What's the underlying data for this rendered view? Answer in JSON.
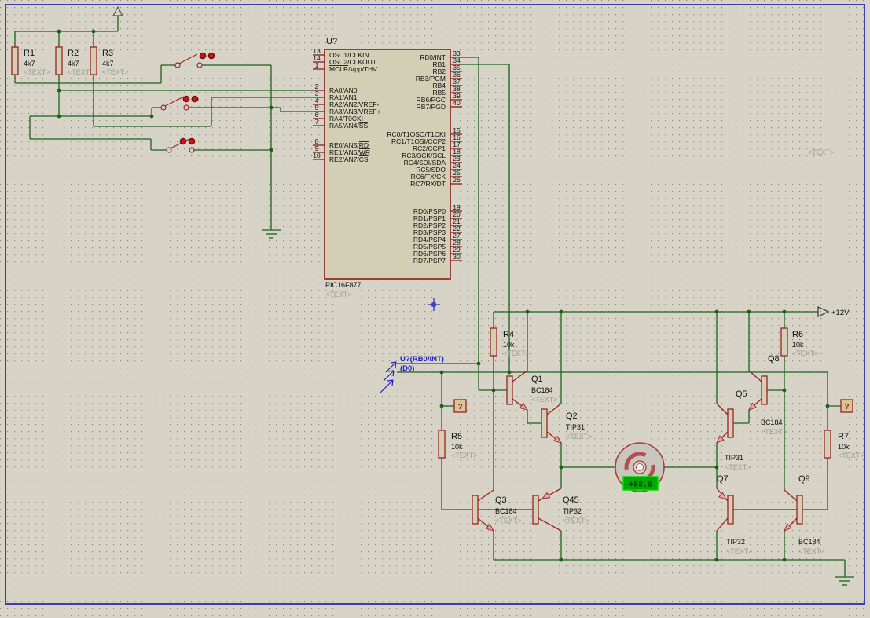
{
  "app": {
    "title": "ISIS schematic sheet"
  },
  "schematic": {
    "chip": {
      "ref": "U?",
      "part": "PIC16F877",
      "placeholder": "<TEXT>",
      "left_pins": [
        {
          "num": "13",
          "name": "OSC1/CLKIN"
        },
        {
          "num": "14",
          "name": "OSC2/CLKOUT"
        },
        {
          "num": "1",
          "name": "~MCLR~/Vpp/THV"
        },
        {
          "num": "2",
          "name": "RA0/AN0"
        },
        {
          "num": "3",
          "name": "RA1/AN1"
        },
        {
          "num": "4",
          "name": "RA2/AN2/VREF-"
        },
        {
          "num": "5",
          "name": "RA3/AN3/VREF+"
        },
        {
          "num": "6",
          "name": "RA4/T0CKI"
        },
        {
          "num": "7",
          "name": "RA5/AN4/~SS~"
        },
        {
          "num": "8",
          "name": "RE0/AN5/~RD~"
        },
        {
          "num": "9",
          "name": "RE1/AN6/~WR~"
        },
        {
          "num": "10",
          "name": "RE2/AN7/~CS~"
        }
      ],
      "right_pins": [
        {
          "num": "33",
          "name": "RB0/INT"
        },
        {
          "num": "34",
          "name": "RB1"
        },
        {
          "num": "35",
          "name": "RB2"
        },
        {
          "num": "36",
          "name": "RB3/PGM"
        },
        {
          "num": "37",
          "name": "RB4"
        },
        {
          "num": "38",
          "name": "RB5"
        },
        {
          "num": "39",
          "name": "RB6/PGC"
        },
        {
          "num": "40",
          "name": "RB7/PGD"
        },
        {
          "num": "15",
          "name": "RC0/T1OSO/T1CKI"
        },
        {
          "num": "16",
          "name": "RC1/T1OSI/CCP2"
        },
        {
          "num": "17",
          "name": "RC2/CCP1"
        },
        {
          "num": "18",
          "name": "RC3/SCK/SCL"
        },
        {
          "num": "23",
          "name": "RC4/SDI/SDA"
        },
        {
          "num": "24",
          "name": "RC5/SDO"
        },
        {
          "num": "25",
          "name": "RC6/TX/CK"
        },
        {
          "num": "26",
          "name": "RC7/RX/DT"
        },
        {
          "num": "19",
          "name": "RD0/PSP0"
        },
        {
          "num": "20",
          "name": "RD1/PSP1"
        },
        {
          "num": "21",
          "name": "RD2/PSP2"
        },
        {
          "num": "22",
          "name": "RD3/PSP3"
        },
        {
          "num": "27",
          "name": "RD4/PSP4"
        },
        {
          "num": "28",
          "name": "RD5/PSP5"
        },
        {
          "num": "29",
          "name": "RD6/PSP6"
        },
        {
          "num": "30",
          "name": "RD7/PSP7"
        }
      ]
    },
    "resistors": [
      {
        "ref": "R1",
        "value": "4k7",
        "placeholder": "<TEXT>"
      },
      {
        "ref": "R2",
        "value": "4k7",
        "placeholder": "<TEXT>"
      },
      {
        "ref": "R3",
        "value": "4k7",
        "placeholder": "<TEXT>"
      },
      {
        "ref": "R4",
        "value": "10k",
        "placeholder": "<TEXT>"
      },
      {
        "ref": "R5",
        "value": "10k",
        "placeholder": "<TEXT>"
      },
      {
        "ref": "R6",
        "value": "10k",
        "placeholder": "<TEXT>"
      },
      {
        "ref": "R7",
        "value": "10k",
        "placeholder": "<TEXT>"
      }
    ],
    "transistors": [
      {
        "ref": "Q1",
        "part": "BC184",
        "placeholder": "<TEXT>"
      },
      {
        "ref": "Q2",
        "part": "TIP31",
        "placeholder": "<TEXT>"
      },
      {
        "ref": "Q3",
        "part": "BC184",
        "placeholder": "<TEXT>"
      },
      {
        "ref": "Q45",
        "part": "TIP32",
        "placeholder": "<TEXT>"
      },
      {
        "ref": "Q8",
        "part": "BC184",
        "placeholder": "<TEXT>"
      },
      {
        "ref": "Q5",
        "part": "TIP31",
        "placeholder": "<TEXT>"
      },
      {
        "ref": "Q7",
        "part": "TIP32",
        "placeholder": "<TEXT>"
      },
      {
        "ref": "Q9",
        "part": "BC184",
        "placeholder": "<TEXT>"
      }
    ],
    "power": {
      "rail_label": "+12V"
    },
    "net_labels": {
      "line1": "U?(RB0/INT)",
      "line2": "(D0)"
    },
    "probes": [
      {
        "label": "?"
      },
      {
        "label": "?"
      }
    ],
    "motor": {
      "display": "+88.8"
    },
    "floating_text": "<TEXT>",
    "colors": {
      "wire": "#1c611c",
      "component": "#9b2323",
      "component_fill": "#d3cfb4",
      "background": "#d7d4c7",
      "grid_dot": "#8f8d7d",
      "frame": "#3c3cae",
      "net_label": "#2222c0",
      "display_bg": "#00a800",
      "display_border": "#00dd00",
      "switch_dot": "#cc1616"
    }
  }
}
